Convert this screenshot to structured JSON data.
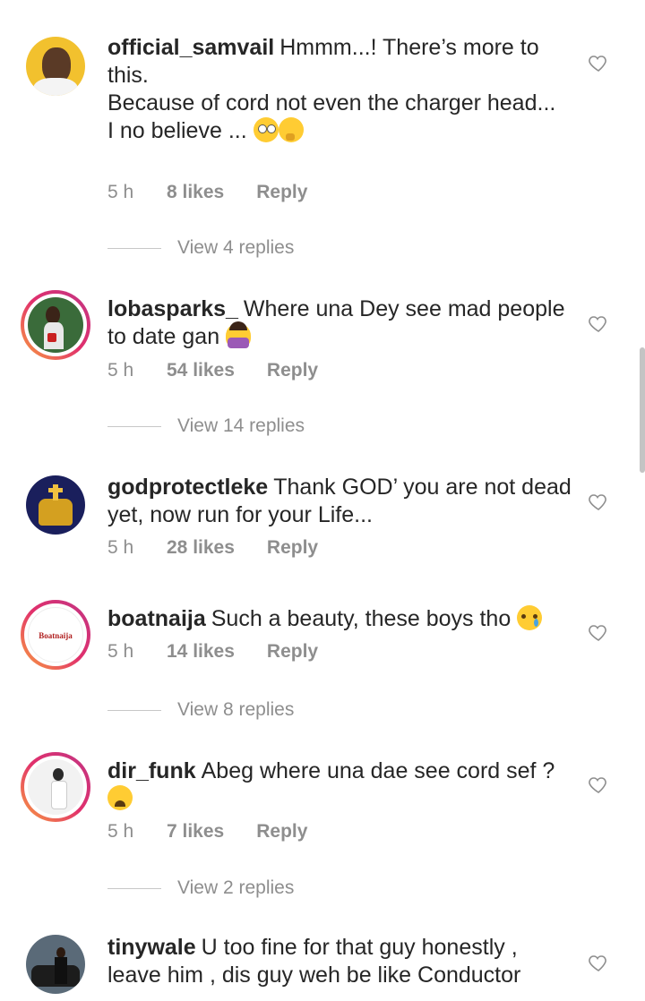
{
  "comments": [
    {
      "username": "official_samvail",
      "text": "Hmmm...! There’s more to this.\nBecause of cord not even the charger head...\nI no believe ...",
      "time": "5 h",
      "likes": "8 likes",
      "reply": "Reply",
      "view_replies": "View 4 replies"
    },
    {
      "username": "lobasparks_",
      "text": "Where una Dey see mad people to date gan",
      "time": "5 h",
      "likes": "54 likes",
      "reply": "Reply",
      "view_replies": "View 14 replies"
    },
    {
      "username": "godprotectleke",
      "text": "Thank GOD’ you are not dead yet, now run for your Life...",
      "time": "5 h",
      "likes": "28 likes",
      "reply": "Reply"
    },
    {
      "username": "boatnaija",
      "text": "Such a beauty, these boys tho",
      "time": "5 h",
      "likes": "14 likes",
      "reply": "Reply",
      "view_replies": "View 8 replies",
      "avatar_label": "Boatnaija"
    },
    {
      "username": "dir_funk",
      "text": "Abeg where una dae see cord sef ?",
      "time": "5 h",
      "likes": "7 likes",
      "reply": "Reply",
      "view_replies": "View 2 replies"
    },
    {
      "username": "tinywale",
      "text": "U too fine for that guy honestly , leave him , dis guy weh be like Conductor"
    }
  ],
  "icons": {
    "like": "heart-outline-icon"
  },
  "colors": {
    "text": "#262626",
    "secondary": "#8e8e8e",
    "story_ring": "#e1306c"
  }
}
